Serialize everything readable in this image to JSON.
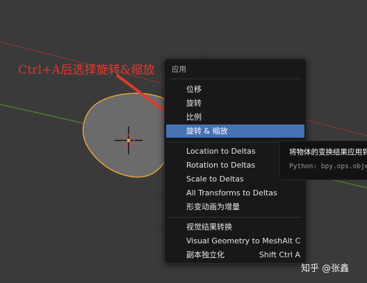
{
  "annotation": "Ctrl+A后选择旋转&缩放",
  "menu": {
    "title": "应用",
    "items": [
      {
        "label": "位移"
      },
      {
        "label": "旋转"
      },
      {
        "label": "比例"
      },
      {
        "label": "旋转 & 缩放",
        "highlighted": true
      },
      {
        "label": "Location to Deltas"
      },
      {
        "label": "Rotation to Deltas"
      },
      {
        "label": "Scale to Deltas"
      },
      {
        "label": "All Transforms to Deltas"
      },
      {
        "label": "形变动画为增量"
      },
      {
        "label": "视觉结果转换"
      },
      {
        "label": "Visual Geometry to Mesh",
        "shortcut": "Alt C"
      },
      {
        "label": "副本独立化",
        "shortcut": "Shift Ctrl A"
      }
    ]
  },
  "tooltip": {
    "title": "将物体的变换结果应用到",
    "python": "Python: bpy.ops.object.transform_apply()"
  },
  "watermark": "知乎 @张鑫",
  "colors": {
    "viewport_bg": "#3a3a3a",
    "grid_red": "#8b3535",
    "grid_green": "#4c8a25",
    "selection_outline": "#e8a23a",
    "highlight": "#4772b3",
    "annotation": "#e03a2f"
  }
}
